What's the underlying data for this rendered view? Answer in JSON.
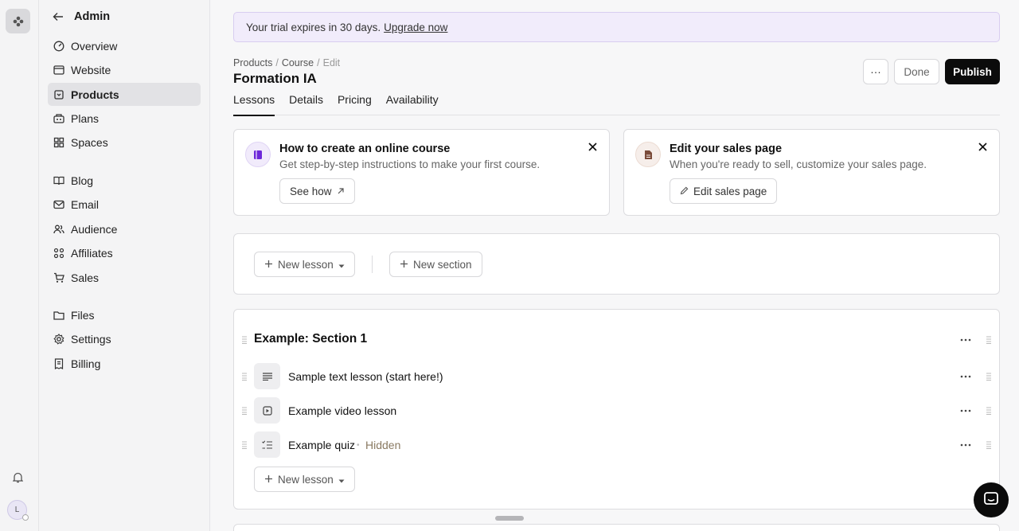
{
  "sidebar": {
    "title": "Admin",
    "items": [
      {
        "label": "Overview",
        "icon": "gauge-icon"
      },
      {
        "label": "Website",
        "icon": "browser-icon"
      },
      {
        "label": "Products",
        "icon": "product-icon",
        "active": true
      },
      {
        "label": "Plans",
        "icon": "plans-icon"
      },
      {
        "label": "Spaces",
        "icon": "spaces-icon"
      },
      {
        "label": "Blog",
        "icon": "book-icon"
      },
      {
        "label": "Email",
        "icon": "mail-icon"
      },
      {
        "label": "Audience",
        "icon": "people-icon"
      },
      {
        "label": "Affiliates",
        "icon": "affiliates-icon"
      },
      {
        "label": "Sales",
        "icon": "cart-icon"
      },
      {
        "label": "Files",
        "icon": "folder-icon"
      },
      {
        "label": "Settings",
        "icon": "gear-icon"
      },
      {
        "label": "Billing",
        "icon": "receipt-icon"
      }
    ]
  },
  "rail": {
    "avatar_initial": "L"
  },
  "banner": {
    "text": "Your trial expires in 30 days.",
    "link": "Upgrade now"
  },
  "breadcrumb": [
    "Products",
    "Course",
    "Edit"
  ],
  "page": {
    "title": "Formation IA"
  },
  "toolbar": {
    "more_label": "···",
    "done_label": "Done",
    "publish_label": "Publish"
  },
  "tabs": [
    "Lessons",
    "Details",
    "Pricing",
    "Availability"
  ],
  "info_cards": [
    {
      "title": "How to create an online course",
      "subtitle": "Get step-by-step instructions to make your first course.",
      "action": "See how",
      "accent": "#6d28d9"
    },
    {
      "title": "Edit your sales page",
      "subtitle": "When you're ready to sell, customize your sales page.",
      "action": "Edit sales page",
      "accent": "#7a4b3a"
    }
  ],
  "actions": {
    "new_lesson": "New lesson",
    "new_section": "New section"
  },
  "section": {
    "title": "Example: Section 1",
    "lessons": [
      {
        "title": "Sample text lesson (start here!)",
        "icon": "text-lines-icon"
      },
      {
        "title": "Example video lesson",
        "icon": "video-icon"
      },
      {
        "title": "Example quiz",
        "icon": "quiz-icon",
        "status": "Hidden"
      }
    ],
    "new_lesson": "New lesson"
  },
  "colors": {
    "banner_bg": "#f1ecfb",
    "primary": "#0b0b0b",
    "hidden_status": "#8a7a62"
  }
}
